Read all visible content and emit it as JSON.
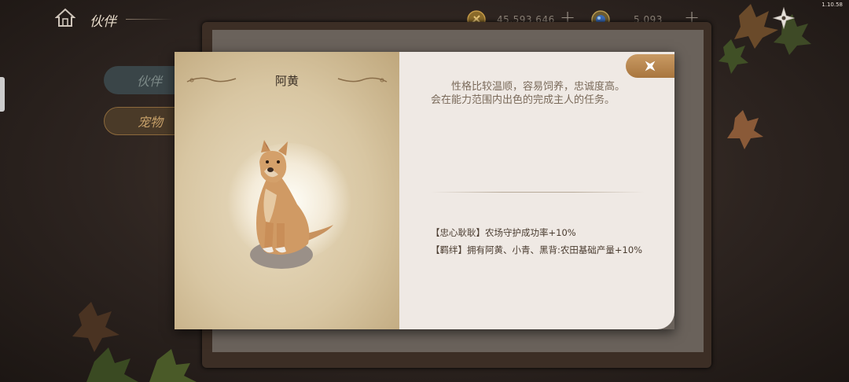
{
  "app": {
    "version": "1.10.58"
  },
  "top_bar": {
    "title": "伙伴",
    "home_icon": "home-icon",
    "gold": {
      "icon": "gold-coin-icon",
      "value": "45,593,646",
      "add": "+"
    },
    "gem": {
      "icon": "blue-gem-icon",
      "value": "5,093",
      "add": "+"
    },
    "menu_icon": "shuriken-menu-icon"
  },
  "side_tabs": [
    {
      "label": "伙伴",
      "active": false
    },
    {
      "label": "宠物",
      "active": true
    }
  ],
  "modal": {
    "pet_name": "阿黄",
    "description_line1": "性格比较温顺，容易饲养，忠诚度高。",
    "description_line2": "会在能力范围内出色的完成主人的任务。",
    "skills": [
      "【忠心耿耿】农场守护成功率+10%",
      "【羁绊】拥有阿黄、小青、黑背:农田基础产量+10%"
    ],
    "close_icon": "close-icon"
  },
  "colors": {
    "accent_gold": "#c99a64",
    "parchment": "#d8c6a2",
    "panel_light": "#efe9e4"
  }
}
